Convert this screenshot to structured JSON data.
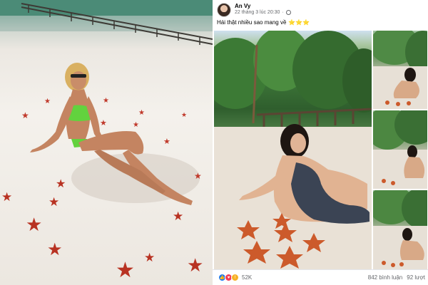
{
  "post": {
    "author": "An Vy",
    "timestamp": "22 tháng 3 lúc 20:30",
    "privacy_icon": "globe-icon",
    "caption": "Hái thật nhiều sao mang về",
    "caption_emoji": "⭐⭐⭐",
    "reactions": {
      "icons": [
        "like-icon",
        "love-icon",
        "wow-icon"
      ],
      "count": "52K"
    },
    "comments": "842 bình luận",
    "shares": "92 lượt"
  },
  "colors": {
    "facebook_blue": "#1877f2",
    "love_red": "#f33e58",
    "wow_yellow": "#f7b125",
    "meta_gray": "#65676b"
  }
}
